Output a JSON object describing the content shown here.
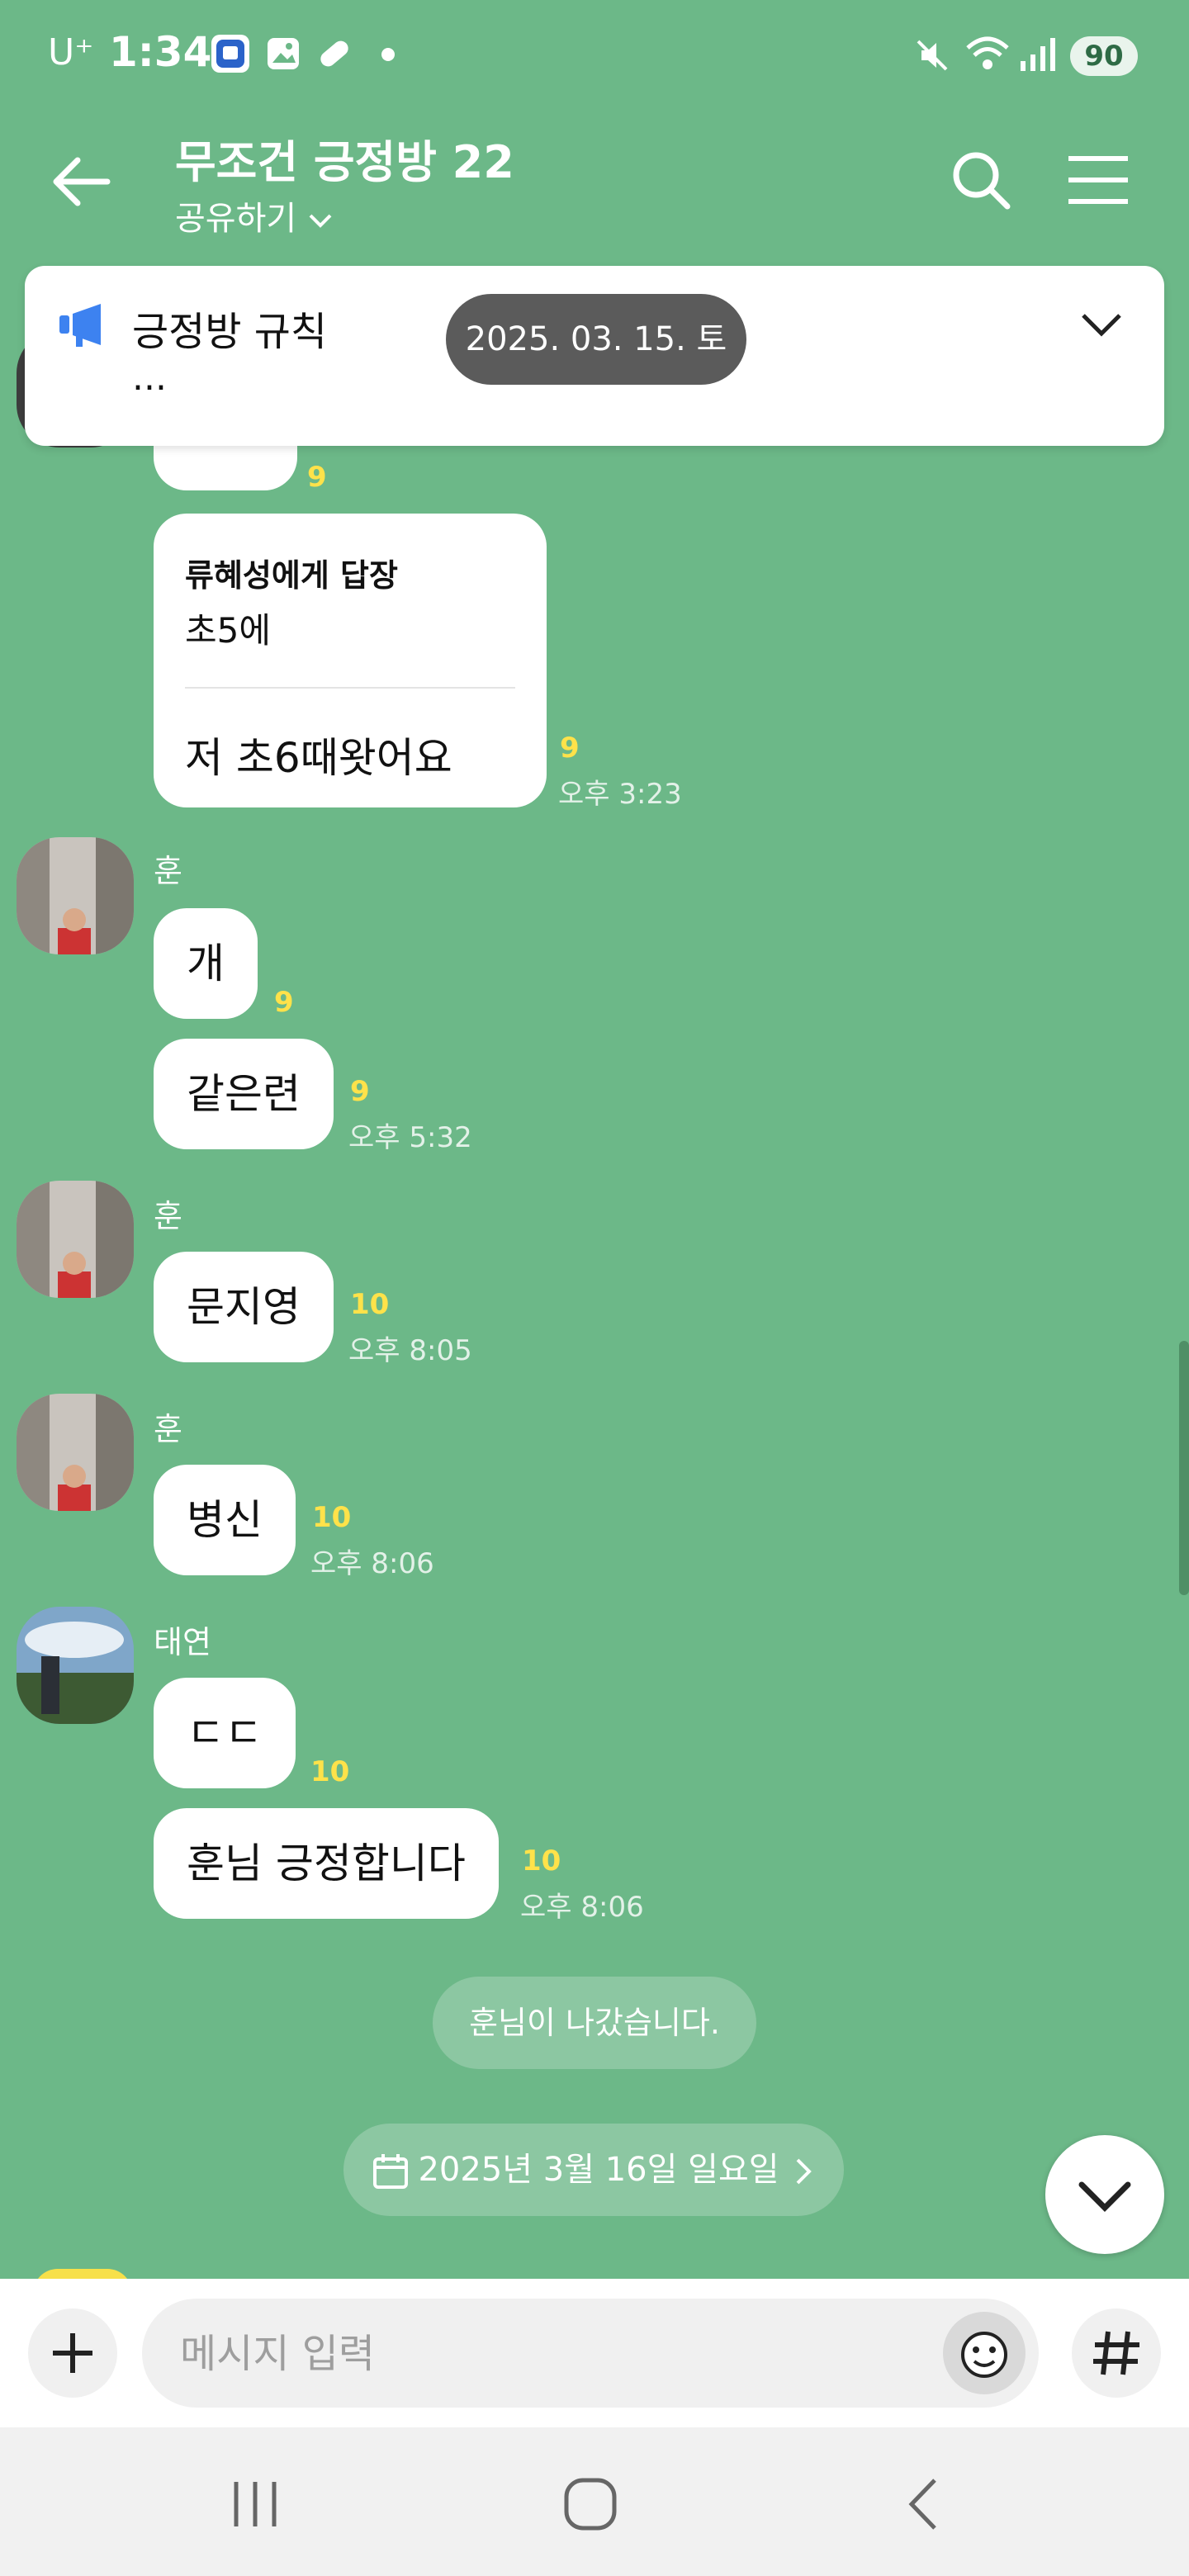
{
  "status_bar": {
    "carrier": "U⁺",
    "time": "1:34",
    "battery": "90"
  },
  "header": {
    "title": "무조건 긍정방 22",
    "share_label": "공유하기"
  },
  "notice": {
    "title": "긍정방 규칙",
    "preview": "..."
  },
  "floating_date": "2025. 03. 15. 토",
  "messages": {
    "m0": {
      "text": "",
      "unread": "9"
    },
    "reply": {
      "reply_to": "류혜성에게 답장",
      "quoted": "초5에",
      "text": "저 초6때왓어요",
      "unread": "9",
      "time": "오후 3:23"
    },
    "hoon1": {
      "name": "훈",
      "m1": "개",
      "m1_unread": "9",
      "m2": "같은련",
      "m2_unread": "9",
      "time": "오후 5:32"
    },
    "hoon2": {
      "name": "훈",
      "text": "문지영",
      "unread": "10",
      "time": "오후 8:05"
    },
    "hoon3": {
      "name": "훈",
      "text": "병신",
      "unread": "10",
      "time": "오후 8:06"
    },
    "taeyeon": {
      "name": "태연",
      "m1": "ㄷㄷ",
      "m1_unread": "10",
      "m2": "훈님 긍정합니다",
      "m2_unread": "10",
      "time": "오후 8:06"
    }
  },
  "system_notice": "훈님이 나갔습니다.",
  "date_divider": "2025년 3월 16일 일요일",
  "input": {
    "placeholder": "메시지 입력"
  },
  "colors": {
    "background": "#6cb888",
    "unread": "#ffe24a",
    "bubble": "#ffffff"
  }
}
